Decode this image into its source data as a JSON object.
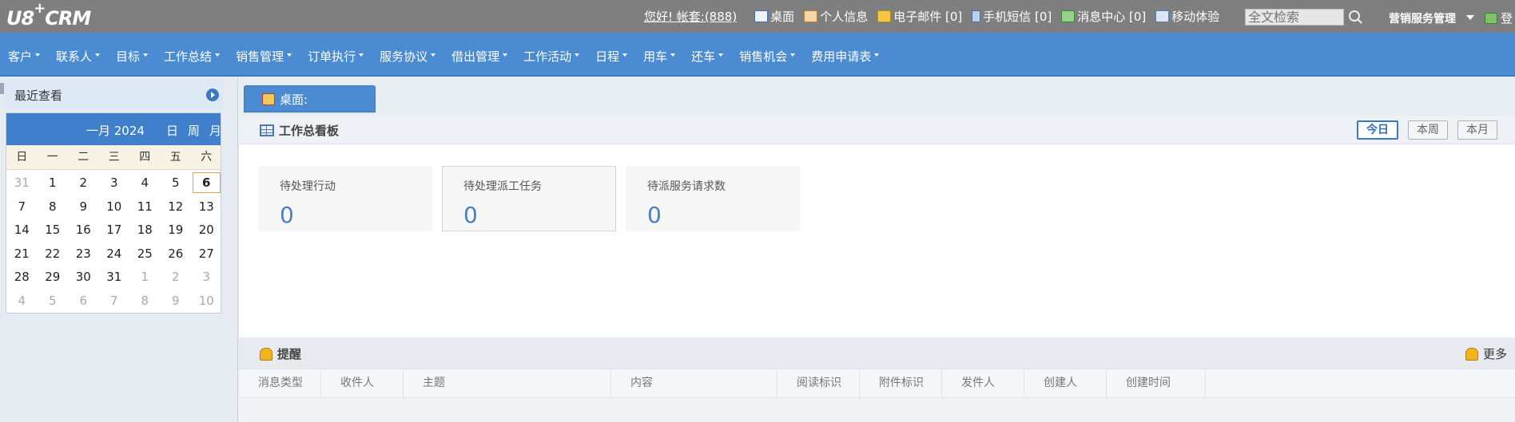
{
  "topbar": {
    "logo": "U8",
    "logo_sup": "+",
    "logo_suffix": "CRM",
    "greeting": "您好! 帐套:(888)",
    "links": [
      {
        "label": "桌面",
        "icon": "home-icon"
      },
      {
        "label": "个人信息",
        "icon": "user-card-icon"
      },
      {
        "label": "电子邮件 [0]",
        "icon": "folder-mail-icon"
      },
      {
        "label": "手机短信 [0]",
        "icon": "phone-icon"
      },
      {
        "label": "消息中心 [0]",
        "icon": "message-icon"
      },
      {
        "label": "移动体验",
        "icon": "mobile-icon"
      }
    ],
    "search_placeholder": "全文检索",
    "role": "营销服务管理",
    "logout": "登"
  },
  "menu": {
    "items": [
      "客户",
      "联系人",
      "目标",
      "工作总结",
      "销售管理",
      "订单执行",
      "服务协议",
      "借出管理",
      "工作活动",
      "日程",
      "用车",
      "还车",
      "销售机会",
      "费用申请表"
    ]
  },
  "sidebar": {
    "recent_title": "最近查看",
    "calendar": {
      "month_label": "一月 2024",
      "modes": [
        "日",
        "周",
        "月"
      ],
      "weekdays": [
        "日",
        "一",
        "二",
        "三",
        "四",
        "五",
        "六"
      ],
      "days": [
        [
          "31",
          "other"
        ],
        [
          "1",
          ""
        ],
        [
          "2",
          ""
        ],
        [
          "3",
          ""
        ],
        [
          "4",
          ""
        ],
        [
          "5",
          ""
        ],
        [
          "6",
          "today"
        ],
        [
          "7",
          ""
        ],
        [
          "8",
          ""
        ],
        [
          "9",
          ""
        ],
        [
          "10",
          ""
        ],
        [
          "11",
          ""
        ],
        [
          "12",
          ""
        ],
        [
          "13",
          ""
        ],
        [
          "14",
          ""
        ],
        [
          "15",
          ""
        ],
        [
          "16",
          ""
        ],
        [
          "17",
          ""
        ],
        [
          "18",
          ""
        ],
        [
          "19",
          ""
        ],
        [
          "20",
          ""
        ],
        [
          "21",
          ""
        ],
        [
          "22",
          ""
        ],
        [
          "23",
          ""
        ],
        [
          "24",
          ""
        ],
        [
          "25",
          ""
        ],
        [
          "26",
          ""
        ],
        [
          "27",
          ""
        ],
        [
          "28",
          ""
        ],
        [
          "29",
          ""
        ],
        [
          "30",
          ""
        ],
        [
          "31",
          ""
        ],
        [
          "1",
          "other"
        ],
        [
          "2",
          "other"
        ],
        [
          "3",
          "other"
        ],
        [
          "4",
          "other"
        ],
        [
          "5",
          "other"
        ],
        [
          "6",
          "other"
        ],
        [
          "7",
          "other"
        ],
        [
          "8",
          "other"
        ],
        [
          "9",
          "other"
        ],
        [
          "10",
          "other"
        ]
      ]
    }
  },
  "main": {
    "tab_label": "桌面:",
    "board": {
      "title": "工作总看板",
      "periods": [
        "今日",
        "本周",
        "本月"
      ],
      "active_period": "今日",
      "cards": [
        {
          "label": "待处理行动",
          "value": "0",
          "selected": false
        },
        {
          "label": "待处理派工任务",
          "value": "0",
          "selected": true
        },
        {
          "label": "待派服务请求数",
          "value": "0",
          "selected": false
        }
      ]
    },
    "reminder": {
      "title": "提醒",
      "more": "更多",
      "columns": [
        "消息类型",
        "收件人",
        "主题",
        "内容",
        "阅读标识",
        "附件标识",
        "发件人",
        "创建人",
        "创建时间"
      ]
    }
  }
}
